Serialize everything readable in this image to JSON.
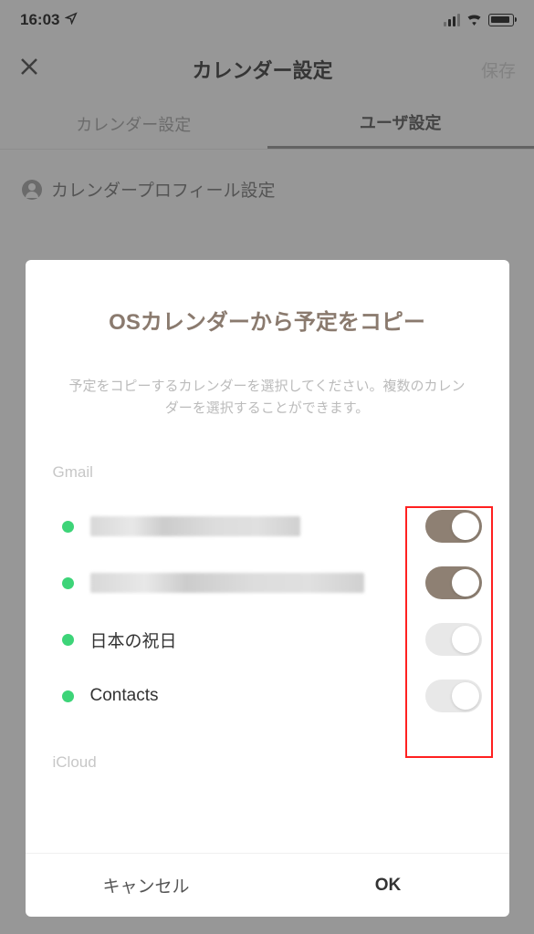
{
  "status": {
    "time": "16:03"
  },
  "nav": {
    "title": "カレンダー設定",
    "save": "保存"
  },
  "tabs": {
    "settings": "カレンダー設定",
    "user": "ユーザ設定"
  },
  "section": {
    "profile": "カレンダープロフィール設定"
  },
  "modal": {
    "title": "OSカレンダーから予定をコピー",
    "description": "予定をコピーするカレンダーを選択してください。複数のカレンダーを選択することができます。",
    "groups": [
      {
        "label": "Gmail",
        "calendars": [
          {
            "name": "",
            "redacted": true,
            "dot_color": "green",
            "toggle": true
          },
          {
            "name": "",
            "redacted": true,
            "dot_color": "green",
            "toggle": true
          },
          {
            "name": "日本の祝日",
            "redacted": false,
            "dot_color": "green",
            "toggle": false
          },
          {
            "name": "Contacts",
            "redacted": false,
            "dot_color": "green",
            "toggle": false
          }
        ]
      },
      {
        "label": "iCloud",
        "calendars": []
      }
    ],
    "cancel": "キャンセル",
    "ok": "OK"
  }
}
